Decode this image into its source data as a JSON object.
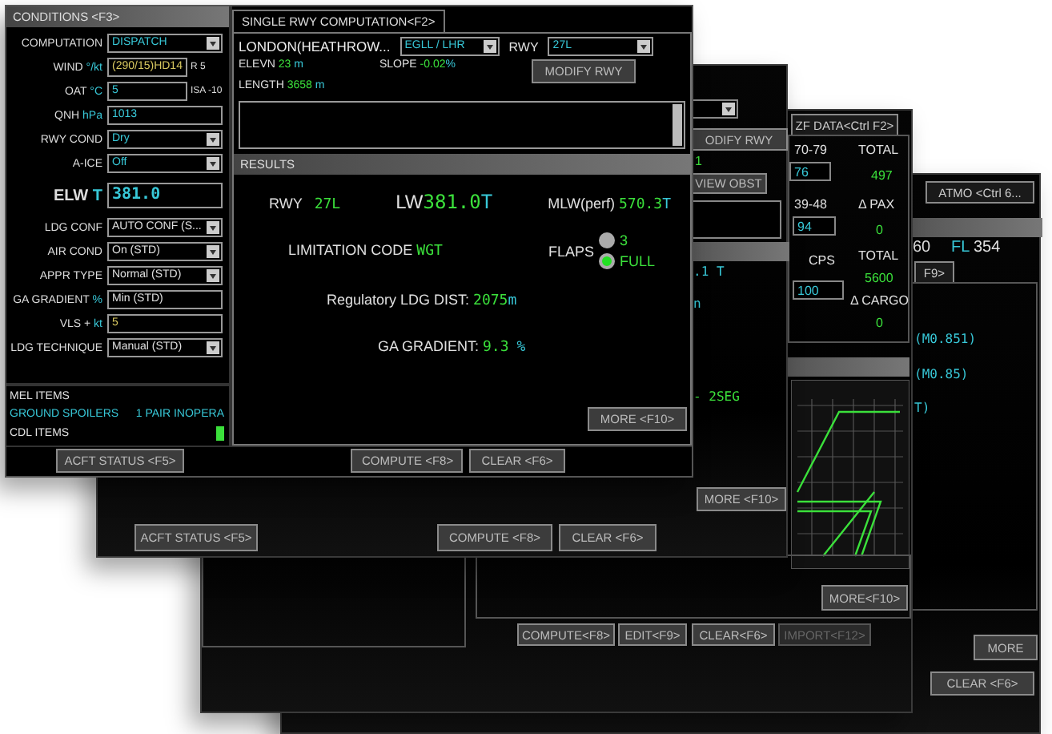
{
  "front_window": {
    "conditions": {
      "tab": "CONDITIONS <F3>",
      "rows": [
        {
          "kind": "dropdown",
          "label": "COMPUTATION",
          "value": "DISPATCH",
          "color": "#38c8d8"
        },
        {
          "kind": "field",
          "label": "WIND",
          "unit": "°/kt",
          "value": "(290/15)HD14",
          "color": "#d8c860",
          "suffix": "R 5"
        },
        {
          "kind": "field",
          "label": "OAT",
          "unit": "°C",
          "value": "5",
          "color": "#38c8d8",
          "suffix": "ISA  -10"
        },
        {
          "kind": "field",
          "label": "QNH",
          "unit": "hPa",
          "value": "1013",
          "color": "#38c8d8"
        },
        {
          "kind": "dropdown",
          "label": "RWY COND",
          "value": "Dry",
          "color": "#38c8d8"
        },
        {
          "kind": "dropdown",
          "label": "A-ICE",
          "value": "Off",
          "color": "#38c8d8"
        },
        {
          "kind": "result",
          "label": "ELW",
          "unit": "T",
          "value": "381.0",
          "color": "#38c8d8"
        },
        {
          "kind": "dropdown",
          "label": "LDG CONF",
          "value": "AUTO CONF (S...",
          "color": "#e0e0e0"
        },
        {
          "kind": "dropdown",
          "label": "AIR COND",
          "value": "On (STD)",
          "color": "#e0e0e0"
        },
        {
          "kind": "dropdown",
          "label": "APPR TYPE",
          "value": "Normal (STD)",
          "color": "#e0e0e0"
        },
        {
          "kind": "field",
          "label": "GA GRADIENT",
          "unit": "%",
          "value": "Min (STD)",
          "color": "#e0e0e0"
        },
        {
          "kind": "field",
          "label": "VLS +",
          "unit": "kt",
          "value": "5",
          "color": "#d8c860"
        },
        {
          "kind": "dropdown",
          "label": "LDG TECHNIQUE",
          "value": "Manual (STD)",
          "color": "#e0e0e0"
        }
      ],
      "mel_heading": "MEL ITEMS",
      "mel_items": [
        {
          "name": "GROUND SPOILERS",
          "status": "1 PAIR INOPERA"
        }
      ],
      "cdl_heading": "CDL ITEMS"
    },
    "runway": {
      "tab": "SINGLE RWY COMPUTATION<F2>",
      "airport": "LONDON(HEATHROW...",
      "airport_code": "EGLL / LHR",
      "rwy_label": "RWY",
      "rwy": "27L",
      "elevn_label": "ELEVN",
      "elevn": "23",
      "elevn_unit": "m",
      "slope_label": "SLOPE",
      "slope": "-0.02",
      "slope_unit": "%",
      "length_label": "LENGTH",
      "length": "3658",
      "length_unit": "m",
      "modify_button": "MODIFY RWY"
    },
    "results": {
      "heading": "RESULTS",
      "rwy_label": "RWY",
      "rwy": "27L",
      "lw_label": "LW",
      "lw": "381.0",
      "lw_unit": "T",
      "mlw_label": "MLW(perf)",
      "mlw": "570.3",
      "mlw_unit": "T",
      "limitation_label": "LIMITATION  CODE",
      "limitation": "WGT",
      "flaps_label": "FLAPS",
      "flaps": [
        {
          "label": "3",
          "selected": false
        },
        {
          "label": "FULL",
          "selected": true
        }
      ],
      "ldg_dist_label": "Regulatory  LDG  DIST:",
      "ldg_dist": "2075",
      "ldg_dist_unit": "m",
      "ga_label": "GA  GRADIENT:",
      "ga": "9.3",
      "ga_unit": "%",
      "more_button": "MORE <F10>"
    },
    "buttons": {
      "acft_status": "ACFT STATUS <F5>",
      "compute": "COMPUTE <F8>",
      "clear": "CLEAR <F6>"
    }
  },
  "rwy_window_back": {
    "modify_button": "ODIFY RWY",
    "value": "1",
    "view_obst_button": "VIEW OBST",
    "result_1": ".1 T",
    "result_2": "n",
    "result_3": "- 2SEG",
    "more_button": "MORE <F10>",
    "acft_status": "ACFT STATUS <F5>",
    "compute": "COMPUTE <F8>",
    "clear": "CLEAR <F6>"
  },
  "zf_window": {
    "tab": "ZF DATA<Ctrl F2>",
    "zone_1": "70-79",
    "zone_1_value": "76",
    "zone_2": "39-48",
    "zone_2_value": "94",
    "cps_label": "CPS",
    "cps_value": "100",
    "total_pax_label": "TOTAL",
    "total_pax": "497",
    "delta_pax_label": "Δ PAX",
    "delta_pax": "0",
    "total_cargo_label": "TOTAL",
    "total_cargo": "5600",
    "delta_cargo_label": "Δ CARGO",
    "delta_cargo": "0",
    "more_button": "MORE<F10>",
    "compute": "COMPUTE<F8>",
    "edit": "EDIT<F9>",
    "clear": "CLEAR<F6>",
    "import": "IMPORT<F12>",
    "import_disabled": true
  },
  "atmo_window": {
    "tab": "ATMO <Ctrl 6...",
    "value": "60",
    "fl_label": "FL",
    "fl": "354",
    "sub_tab": "F9>",
    "mach_1": "(M0.851)",
    "mach_2": "(M0.85)",
    "line_3": "T)",
    "more_button": "MORE",
    "clear": "CLEAR <F6>"
  }
}
